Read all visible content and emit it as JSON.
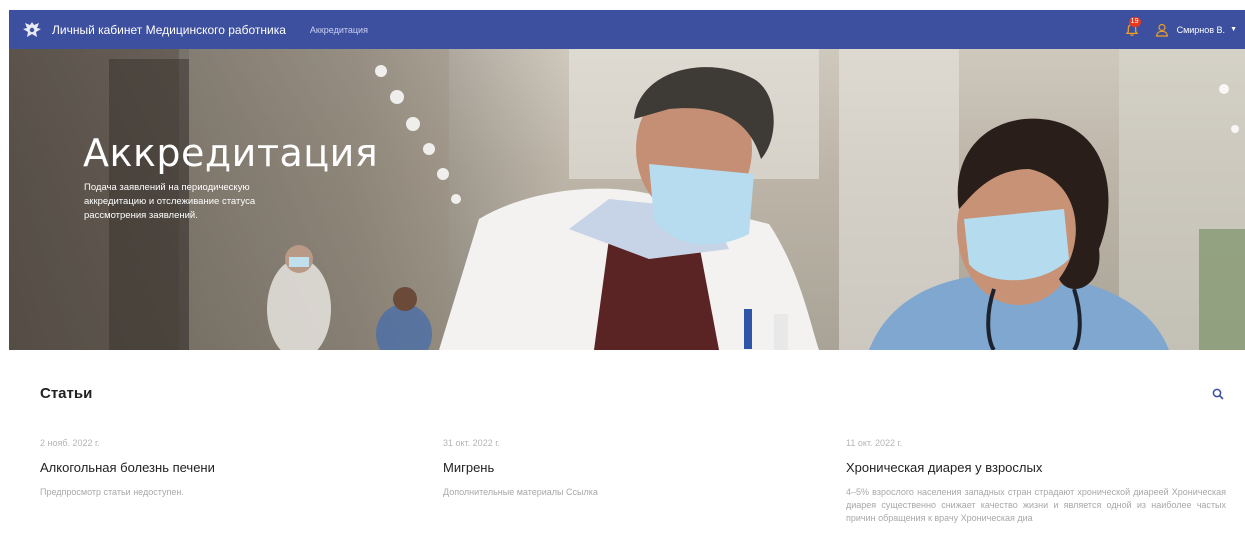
{
  "header": {
    "brand": "Личный кабинет Медицинского работника",
    "nav_link": "Аккредитация",
    "notification_count": "19",
    "user_name": "Смирнов В."
  },
  "hero": {
    "title": "Аккредитация",
    "subtitle": "Подача заявлений на периодическую аккредитацию и отслеживание статуса рассмотрения заявлений."
  },
  "articles_section": {
    "title": "Статьи",
    "items": [
      {
        "date": "2 нояб. 2022 г.",
        "title": "Алкогольная болезнь печени",
        "text": "Предпросмотр статьи недоступен."
      },
      {
        "date": "31 окт. 2022 г.",
        "title": "Мигрень",
        "text": "Дополнительные материалы Ссылка"
      },
      {
        "date": "11 окт. 2022 г.",
        "title": "Хроническая диарея у взрослых",
        "text": "4–5% взрослого населения западных стран страдают хронической диареей Хроническая диарея существенно снижает качество жизни и является одной из наиболее частых причин обращения к врачу Хроническая диа"
      }
    ]
  },
  "colors": {
    "navbar": "#3d4f9f",
    "accent": "#3d4f9f",
    "badge": "#e5391f"
  }
}
